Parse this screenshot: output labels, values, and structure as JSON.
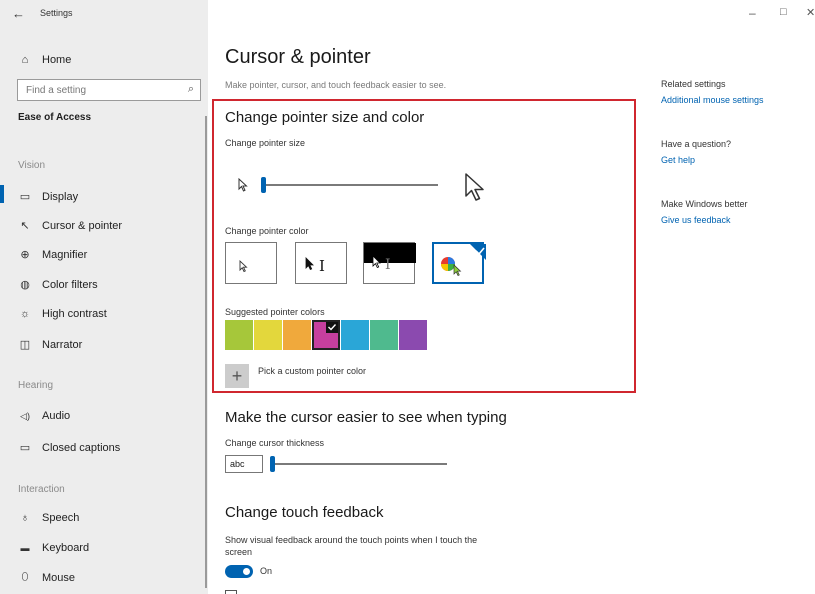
{
  "window": {
    "back_glyph": "←",
    "title": "Settings",
    "minimize_glyph": "–",
    "maximize_glyph": "□",
    "close_glyph": "✕"
  },
  "sidebar": {
    "home": {
      "icon": "home-icon",
      "glyph": "⌂",
      "label": "Home"
    },
    "search": {
      "placeholder": "Find a setting",
      "icon": "search-icon",
      "glyph": "⌕"
    },
    "category": "Ease of Access",
    "sections": {
      "vision": "Vision",
      "hearing": "Hearing",
      "interaction": "Interaction"
    },
    "vision_items": [
      {
        "label": "Display",
        "icon": "display-icon",
        "glyph": "▭"
      },
      {
        "label": "Cursor & pointer",
        "icon": "cursor-pointer-icon",
        "glyph": "↖"
      },
      {
        "label": "Magnifier",
        "icon": "magnifier-icon",
        "glyph": "⊕"
      },
      {
        "label": "Color filters",
        "icon": "color-filters-icon",
        "glyph": "◍"
      },
      {
        "label": "High contrast",
        "icon": "high-contrast-icon",
        "glyph": "☼"
      },
      {
        "label": "Narrator",
        "icon": "narrator-icon",
        "glyph": "◫"
      }
    ],
    "hearing_items": [
      {
        "label": "Audio",
        "icon": "audio-icon",
        "glyph": "◁)"
      },
      {
        "label": "Closed captions",
        "icon": "closed-captions-icon",
        "glyph": "▭"
      }
    ],
    "interaction_items": [
      {
        "label": "Speech",
        "icon": "microphone-icon",
        "glyph": "♁"
      },
      {
        "label": "Keyboard",
        "icon": "keyboard-icon",
        "glyph": "▬"
      },
      {
        "label": "Mouse",
        "icon": "mouse-icon",
        "glyph": "⬯"
      }
    ],
    "active_index": 1
  },
  "main": {
    "title": "Cursor & pointer",
    "subtitle": "Make pointer, cursor, and touch feedback easier to see.",
    "pointer_section": {
      "heading": "Change pointer size and color",
      "size_label": "Change pointer size",
      "size_value": 0.0,
      "color_label": "Change pointer color",
      "color_options": [
        "white",
        "black",
        "inverted",
        "custom"
      ],
      "selected_color_option": 3,
      "suggested_label": "Suggested pointer colors",
      "suggested_colors": [
        "#a6c73a",
        "#e3d73c",
        "#f0a93c",
        "#c63f9e",
        "#2aa6d7",
        "#4fba8e",
        "#8b4aaf"
      ],
      "selected_suggested": 3,
      "custom_plus": "+",
      "custom_label": "Pick a custom pointer color"
    },
    "cursor_section": {
      "heading": "Make the cursor easier to see when typing",
      "thickness_label": "Change cursor thickness",
      "preview_text": "abc",
      "thickness_value": 0.0
    },
    "touch_section": {
      "heading": "Change touch feedback",
      "description": "Show visual feedback around the touch points when I touch the screen",
      "toggle_state": "On"
    }
  },
  "related": {
    "heading": "Related settings",
    "link": "Additional mouse settings",
    "question_heading": "Have a question?",
    "question_link": "Get help",
    "better_heading": "Make Windows better",
    "better_link": "Give us feedback"
  },
  "colors": {
    "accent": "#0063b1",
    "highlight_border": "#d0272f",
    "sidebar_bg": "#ededed"
  }
}
